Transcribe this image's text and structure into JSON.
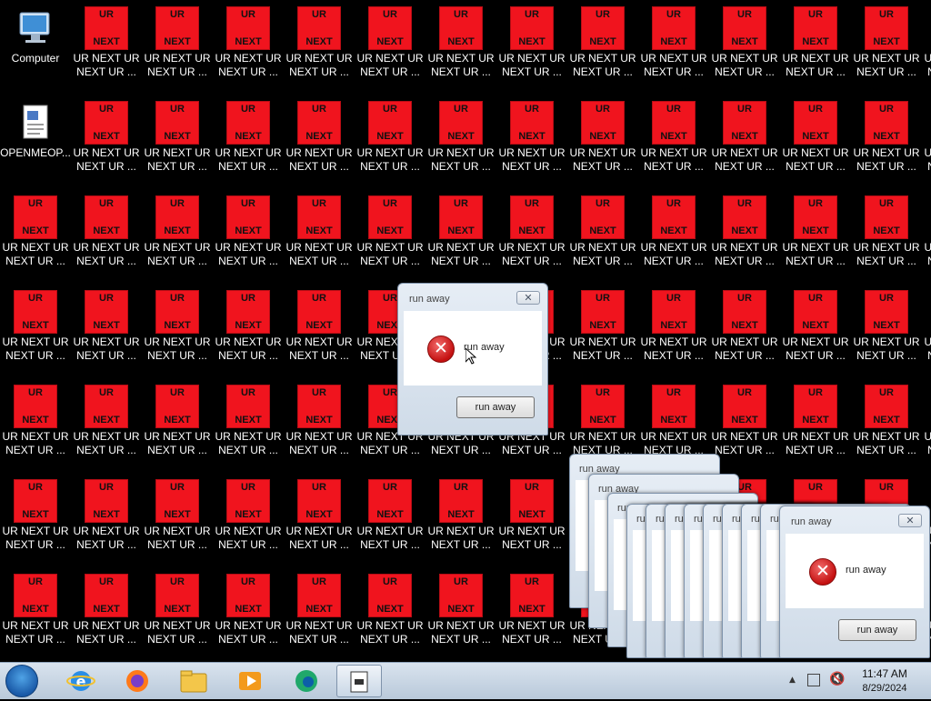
{
  "desktop": {
    "computer_label": "Computer",
    "openmeo_label": "OPENMEOP...",
    "tile_top": "UR",
    "tile_bottom": "NEXT",
    "caption_line1": "UR NEXT UR",
    "caption_line2": "NEXT UR ...",
    "tile_color": "#f0141e"
  },
  "dialog": {
    "title": "run away",
    "message": "run away",
    "button": "run away",
    "close": "✕"
  },
  "taskbar": {
    "time": "11:47 AM",
    "date": "8/29/2024",
    "apps": [
      "start-orb",
      "internet-explorer-icon",
      "firefox-icon",
      "file-explorer-icon",
      "media-player-icon",
      "edge-icon",
      "active-app-icon"
    ]
  }
}
